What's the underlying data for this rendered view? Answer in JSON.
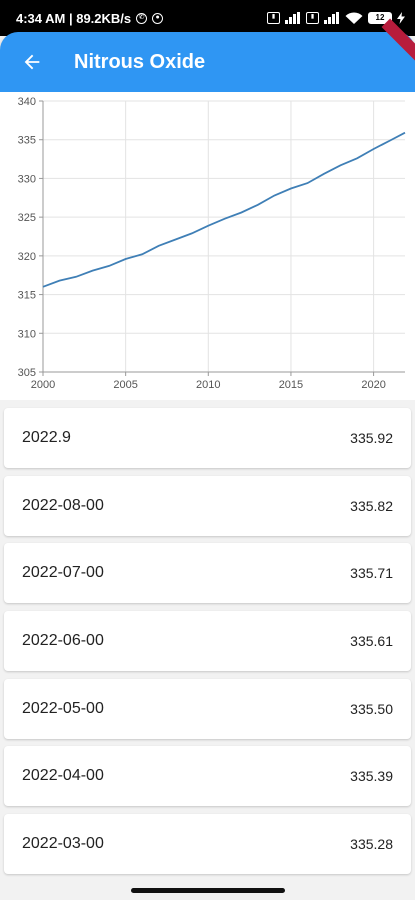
{
  "statusbar": {
    "time_speed": "4:34 AM | 89.2KB/s",
    "battery": "12"
  },
  "appbar": {
    "title": "Nitrous Oxide"
  },
  "chart_data": {
    "type": "line",
    "title": "",
    "xlabel": "",
    "ylabel": "",
    "xlim": [
      2000,
      2021.9
    ],
    "ylim": [
      305,
      340
    ],
    "x_ticks": [
      "2000",
      "2005",
      "2010",
      "2015",
      "2020"
    ],
    "y_ticks": [
      "305",
      "310",
      "315",
      "320",
      "325",
      "330",
      "335",
      "340"
    ],
    "grid": true,
    "line_color": "#3f7fb6",
    "series": [
      {
        "x": [
          2000,
          2001,
          2002,
          2003,
          2004,
          2005,
          2006,
          2007,
          2008,
          2009,
          2010,
          2011,
          2012,
          2013,
          2014,
          2015,
          2016,
          2017,
          2018,
          2019,
          2020,
          2021,
          2021.9
        ],
        "values": [
          316.0,
          316.8,
          317.3,
          318.1,
          318.7,
          319.6,
          320.2,
          321.3,
          322.1,
          322.9,
          323.9,
          324.8,
          325.6,
          326.6,
          327.8,
          328.7,
          329.4,
          330.6,
          331.7,
          332.6,
          333.8,
          334.9,
          335.9
        ]
      }
    ]
  },
  "list": {
    "rows": [
      {
        "date": "2022.9",
        "value": "335.92"
      },
      {
        "date": "2022-08-00",
        "value": "335.82"
      },
      {
        "date": "2022-07-00",
        "value": "335.71"
      },
      {
        "date": "2022-06-00",
        "value": "335.61"
      },
      {
        "date": "2022-05-00",
        "value": "335.50"
      },
      {
        "date": "2022-04-00",
        "value": "335.39"
      },
      {
        "date": "2022-03-00",
        "value": "335.28"
      }
    ]
  },
  "colors": {
    "appbar": "#2f96f3",
    "line": "#3f7fb6"
  }
}
